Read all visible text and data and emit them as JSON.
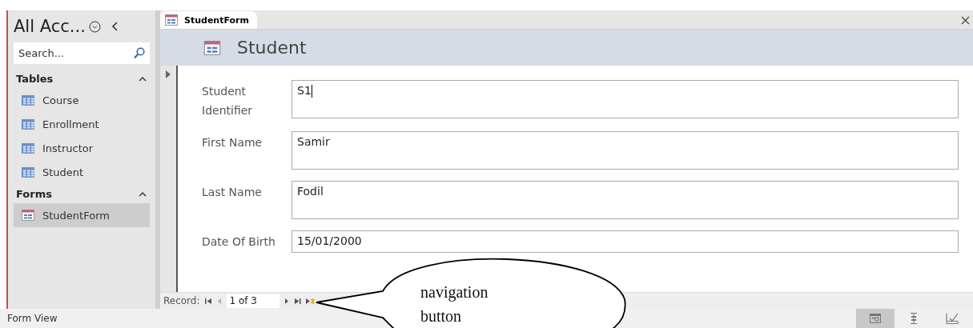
{
  "nav_pane": {
    "title": "All Acc...",
    "search": {
      "placeholder": "Search..."
    },
    "groups": [
      {
        "label": "Tables",
        "expanded": true,
        "items": [
          {
            "label": "Course",
            "kind": "table",
            "selected": false
          },
          {
            "label": "Enrollment",
            "kind": "table",
            "selected": false
          },
          {
            "label": "Instructor",
            "kind": "table",
            "selected": false
          },
          {
            "label": "Student",
            "kind": "table",
            "selected": false
          }
        ]
      },
      {
        "label": "Forms",
        "expanded": true,
        "items": [
          {
            "label": "StudentForm",
            "kind": "form",
            "selected": true
          }
        ]
      }
    ]
  },
  "document_tab": {
    "label": "StudentForm"
  },
  "form": {
    "title": "Student",
    "fields": [
      {
        "label": "Student Identifier",
        "value": "S1",
        "tall": true,
        "focused": true
      },
      {
        "label": "First Name",
        "value": "Samir",
        "tall": true,
        "focused": false
      },
      {
        "label": "Last Name",
        "value": "Fodil",
        "tall": true,
        "focused": false
      },
      {
        "label": "Date Of Birth",
        "value": "15/01/2000",
        "tall": false,
        "focused": false
      }
    ]
  },
  "record_nav": {
    "label": "Record:",
    "position": "1 of 3"
  },
  "callout": {
    "text": "navigation button"
  },
  "status_bar": {
    "text": "Form View",
    "views": [
      {
        "kind": "form",
        "selected": true
      },
      {
        "kind": "layout",
        "selected": false
      },
      {
        "kind": "design",
        "selected": false
      }
    ]
  }
}
